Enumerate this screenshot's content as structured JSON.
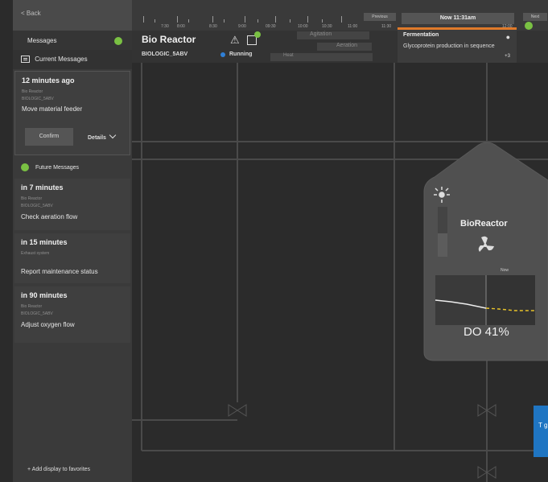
{
  "sidebar": {
    "back_label": "< Back",
    "messages_label": "Messages",
    "current_messages_label": "Current Messages",
    "current_card": {
      "when": "12 minutes ago",
      "source": "Bio Reactor",
      "device": "BIOLOGIC_5ABV",
      "action": "Move material feeder",
      "confirm_label": "Confirm",
      "details_label": "Details"
    },
    "future_messages_label": "Future Messages",
    "future_cards": [
      {
        "when": "in 7 minutes",
        "source": "Bio Reactor",
        "device": "BIOLOGIC_5ABV",
        "action": "Check aeration flow"
      },
      {
        "when": "in 15 minutes",
        "source": "Exhaust system",
        "device": "",
        "action": "Report maintenance status"
      },
      {
        "when": "in 90 minutes",
        "source": "Bio Reactor",
        "device": "BIOLOGIC_5ABV",
        "action": "Adjust oxygen flow"
      }
    ],
    "add_display_label": "Add display to favorites"
  },
  "timeline": {
    "ticks": [
      "7:30",
      "8:00",
      "8:30",
      "9:00",
      "09:30",
      "10:00",
      "10:30",
      "11:00",
      "11:30",
      "12:00"
    ],
    "previous_label": "Previous",
    "now_label": "Now  11:31am",
    "next_label": "Next"
  },
  "header": {
    "title": "Bio  Reactor",
    "subtitle": "BIOLOGIC_5ABV",
    "status": "Running",
    "agitation_label": "Agitation",
    "aeration_label": "Aeration",
    "heat_label": "Heat",
    "fermentation": {
      "title": "Fermentation",
      "description": "Glycoprotein production in sequence",
      "more": "+3"
    }
  },
  "reactor": {
    "title": "BioReactor",
    "now_label": "Now",
    "do_value": "DO 41%"
  },
  "teal_panel": {
    "text": "T g"
  },
  "colors": {
    "accent_green": "#7ac143",
    "running_blue": "#2f7fd6",
    "orange": "#e07a2a",
    "yellow": "#e8c32a"
  }
}
